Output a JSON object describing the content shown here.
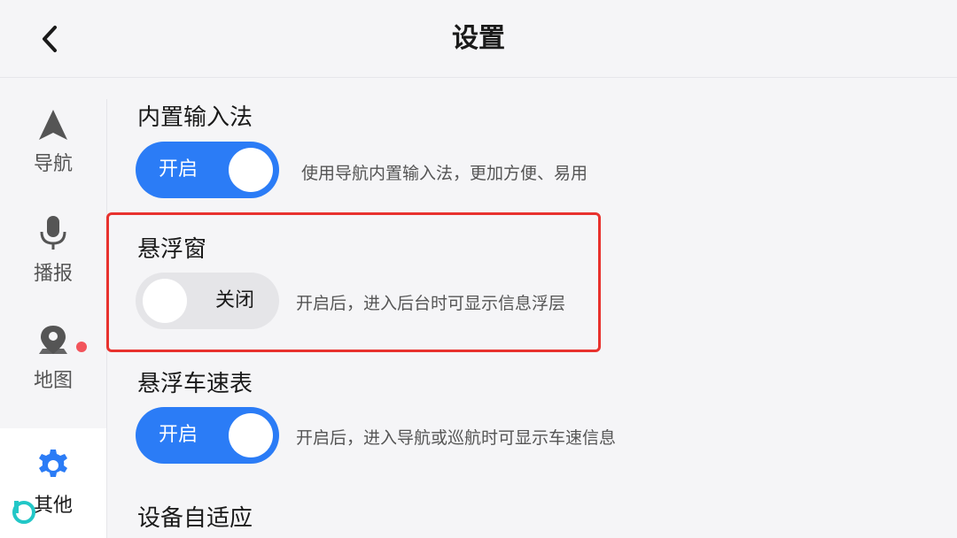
{
  "header": {
    "title": "设置"
  },
  "sidebar": {
    "items": [
      {
        "label": "导航",
        "icon": "navigation-arrow-icon"
      },
      {
        "label": "播报",
        "icon": "microphone-icon"
      },
      {
        "label": "地图",
        "icon": "map-pin-icon",
        "has_badge": true
      },
      {
        "label": "其他",
        "icon": "gear-icon",
        "active": true
      }
    ]
  },
  "settings": [
    {
      "title": "内置输入法",
      "toggle_label": "开启",
      "state": "on",
      "description": "使用导航内置输入法，更加方便、易用"
    },
    {
      "title": "悬浮窗",
      "toggle_label": "关闭",
      "state": "off",
      "description": "开启后，进入后台时可显示信息浮层"
    },
    {
      "title": "悬浮车速表",
      "toggle_label": "开启",
      "state": "on",
      "description": "开启后，进入导航或巡航时可显示车速信息"
    },
    {
      "title": "设备自适应"
    }
  ],
  "colors": {
    "accent": "#2b7cf6",
    "highlight": "#e8322e",
    "badge": "#f2545b"
  }
}
